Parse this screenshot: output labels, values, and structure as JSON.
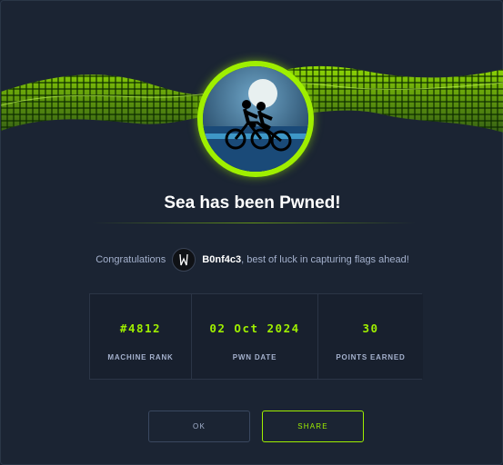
{
  "modal": {
    "title": "Sea has been Pwned!",
    "congrats_prefix": "Congratulations",
    "username": "B0nf4c3",
    "congrats_suffix": ", best of luck in capturing flags ahead!"
  },
  "stats": [
    {
      "value": "#4812",
      "label": "MACHINE RANK"
    },
    {
      "value": "02 Oct 2024",
      "label": "PWN DATE"
    },
    {
      "value": "30",
      "label": "POINTS EARNED"
    }
  ],
  "buttons": {
    "ok": "OK",
    "share": "SHARE"
  },
  "colors": {
    "accent": "#9fef00",
    "background": "#1a2332",
    "muted_text": "#a4b1cd"
  }
}
